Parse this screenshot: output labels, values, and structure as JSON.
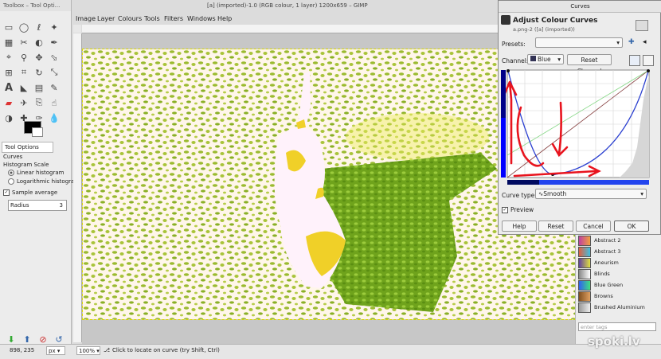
{
  "toolbox": {
    "title": "Toolbox – Tool Opti...",
    "tool_options_tab": "Tool Options",
    "tool_name": "Curves",
    "histogram_scale_label": "Histogram Scale",
    "linear": "Linear histogram",
    "logarithmic": "Logarithmic histogram",
    "sample_average": "Sample average",
    "radius_label": "Radius",
    "radius_value": "3"
  },
  "window": {
    "title": "[a] (imported)-1.0 (RGB colour, 1 layer) 1200x659 – GIMP",
    "menus": [
      "Image",
      "Layer",
      "Colours",
      "Tools",
      "Filters",
      "Windows",
      "Help"
    ]
  },
  "status": {
    "coords": "898, 235",
    "unit": "px",
    "zoom": "100%",
    "message": "Click to locate on curve (try Shift, Ctrl)"
  },
  "curves_dialog": {
    "window_title": "Curves",
    "heading": "Adjust Colour Curves",
    "subheading": "a.png-2 ([a] (imported))",
    "presets_label": "Presets:",
    "channel_label": "Channel:",
    "channel_value": "Blue",
    "reset_channel": "Reset Channel",
    "curve_type_label": "Curve type:",
    "curve_type_value": "Smooth",
    "preview_label": "Preview",
    "buttons": [
      "Help",
      "Reset",
      "Cancel",
      "OK"
    ]
  },
  "gradients": [
    "Abstract 2",
    "Abstract 3",
    "Aneurism",
    "Blinds",
    "Blue Green",
    "Browns",
    "Brushed Aluminium"
  ],
  "gradient_colors": [
    [
      "#c040a0",
      "#f0a040"
    ],
    [
      "#e06040",
      "#40c0e0"
    ],
    [
      "#6040a0",
      "#e0e040"
    ],
    [
      "#888888",
      "#ffffff"
    ],
    [
      "#3060f0",
      "#40e080"
    ],
    [
      "#805020",
      "#e0a060"
    ],
    [
      "#999999",
      "#eeeeee"
    ]
  ],
  "filter_tags_placeholder": "enter tags",
  "watermark": "spoki.lv",
  "colors": {
    "image_green": "#8fb52a",
    "image_bg": "#fff6ea",
    "curve_blue": "#2a3fd0",
    "annotation_red": "#e8141e"
  }
}
